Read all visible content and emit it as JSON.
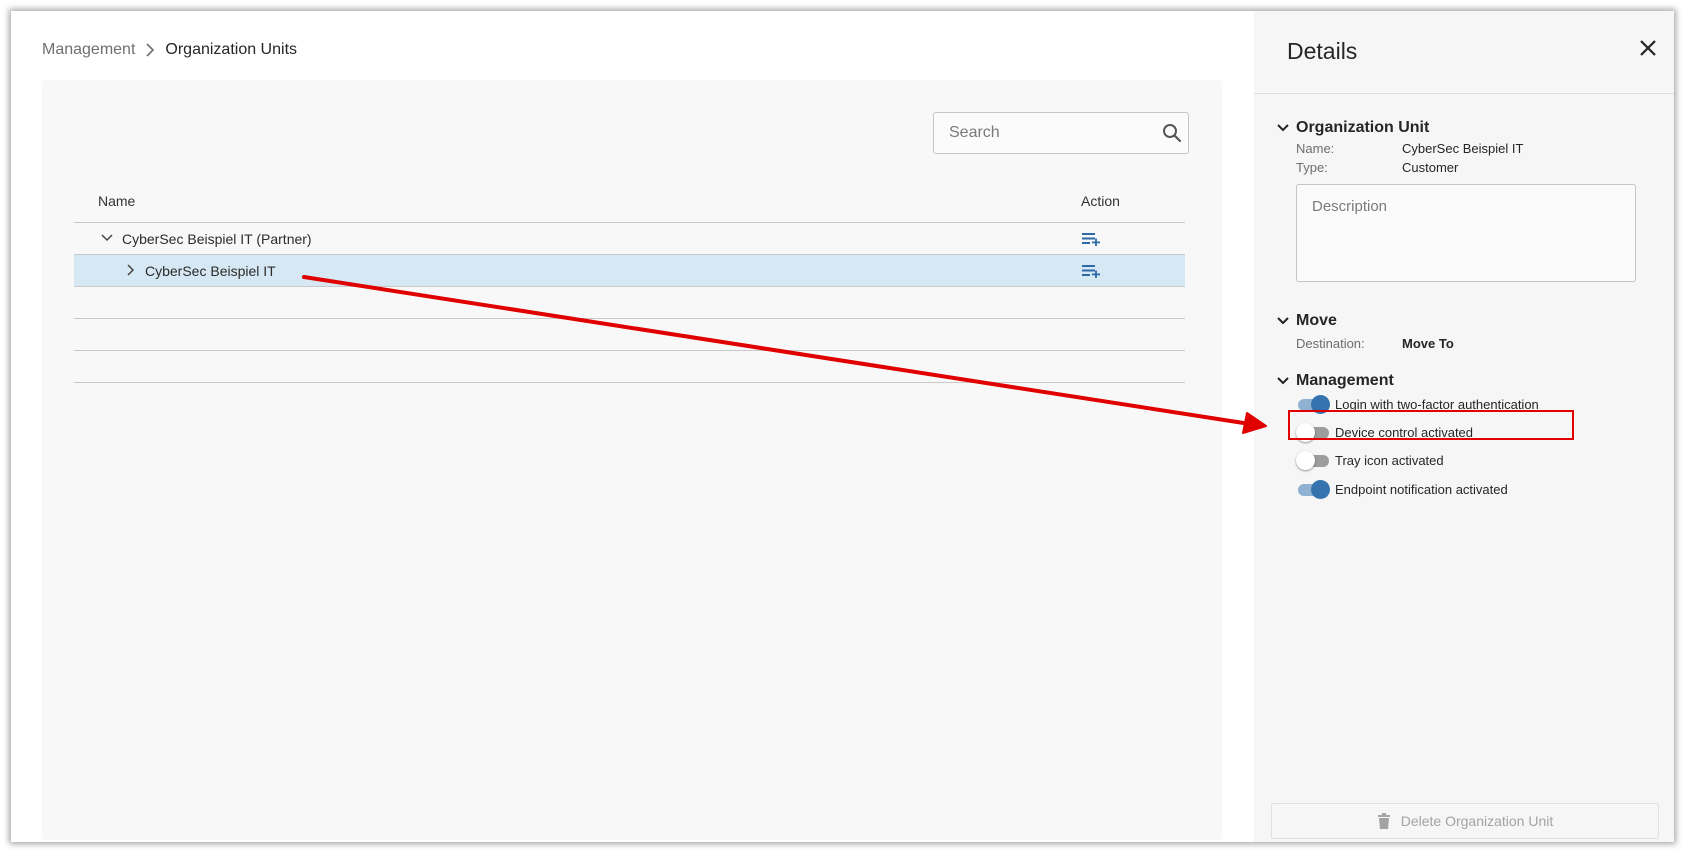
{
  "breadcrumb": {
    "root": "Management",
    "current": "Organization Units"
  },
  "search": {
    "placeholder": "Search"
  },
  "table": {
    "headers": {
      "name": "Name",
      "action": "Action"
    },
    "rows": [
      {
        "label": "CyberSec Beispiel IT (Partner)",
        "expanded": true
      },
      {
        "label": "CyberSec Beispiel IT",
        "expanded": false,
        "selected": true
      }
    ]
  },
  "details": {
    "title": "Details",
    "org_unit": {
      "heading": "Organization Unit",
      "name_label": "Name:",
      "name_value": "CyberSec Beispiel IT",
      "type_label": "Type:",
      "type_value": "Customer",
      "description_placeholder": "Description"
    },
    "move": {
      "heading": "Move",
      "destination_label": "Destination:",
      "destination_link": "Move To"
    },
    "management": {
      "heading": "Management",
      "toggles": [
        {
          "label": "Login with two-factor authentication",
          "on": true
        },
        {
          "label": "Device control activated",
          "on": false
        },
        {
          "label": "Tray icon activated",
          "on": false
        },
        {
          "label": "Endpoint notification activated",
          "on": true
        }
      ]
    },
    "delete_label": "Delete Organization Unit"
  },
  "colors": {
    "accent": "#3573ae",
    "selected_row": "#d6e8f3",
    "annotation": "#e00000"
  }
}
